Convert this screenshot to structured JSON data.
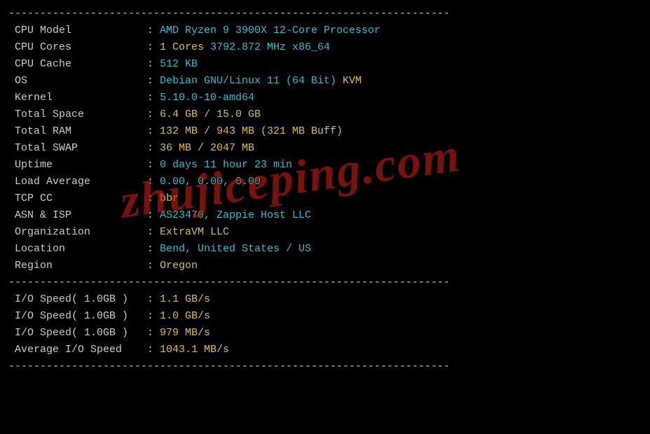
{
  "dash": "----------------------------------------------------------------------",
  "watermark": "zhujiceping.com",
  "rows": [
    {
      "label": "CPU Model            ",
      "parts": [
        {
          "cls": "cyan",
          "txt": "AMD Ryzen 9 3900X 12-Core Processor"
        }
      ]
    },
    {
      "label": "CPU Cores            ",
      "parts": [
        {
          "cls": "yellow",
          "txt": "1 Cores"
        },
        {
          "cls": "cyan",
          "txt": " 3792.872 MHz x86_64"
        }
      ]
    },
    {
      "label": "CPU Cache            ",
      "parts": [
        {
          "cls": "cyan",
          "txt": "512 KB"
        }
      ]
    },
    {
      "label": "OS                   ",
      "parts": [
        {
          "cls": "cyan",
          "txt": "Debian GNU/Linux 11 (64 Bit) "
        },
        {
          "cls": "yellow",
          "txt": "KVM"
        }
      ]
    },
    {
      "label": "Kernel               ",
      "parts": [
        {
          "cls": "cyan",
          "txt": "5.10.0-10-amd64"
        }
      ]
    },
    {
      "label": "Total Space          ",
      "parts": [
        {
          "cls": "yellow",
          "txt": "6.4 GB / 15.0 GB"
        }
      ]
    },
    {
      "label": "Total RAM            ",
      "parts": [
        {
          "cls": "yellow",
          "txt": "132 MB / 943 MB (321 MB Buff)"
        }
      ]
    },
    {
      "label": "Total SWAP           ",
      "parts": [
        {
          "cls": "yellow",
          "txt": "36 MB / 2047 MB"
        }
      ]
    },
    {
      "label": "Uptime               ",
      "parts": [
        {
          "cls": "cyan",
          "txt": "0 days 11 hour 23 min"
        }
      ]
    },
    {
      "label": "Load Average         ",
      "parts": [
        {
          "cls": "cyan",
          "txt": "0.00, 0.00, 0.00"
        }
      ]
    },
    {
      "label": "TCP CC               ",
      "parts": [
        {
          "cls": "yellow",
          "txt": "bbr"
        }
      ]
    },
    {
      "label": "ASN & ISP            ",
      "parts": [
        {
          "cls": "cyan",
          "txt": "AS23470, Zappie Host LLC"
        }
      ]
    },
    {
      "label": "Organization         ",
      "parts": [
        {
          "cls": "yellow",
          "txt": "ExtraVM LLC"
        }
      ]
    },
    {
      "label": "Location             ",
      "parts": [
        {
          "cls": "cyan",
          "txt": "Bend, United States / US"
        }
      ]
    },
    {
      "label": "Region               ",
      "parts": [
        {
          "cls": "yellow",
          "txt": "Oregon"
        }
      ]
    }
  ],
  "io_rows": [
    {
      "label": "I/O Speed( 1.0GB )   ",
      "parts": [
        {
          "cls": "yellow",
          "txt": "1.1 GB/s"
        }
      ]
    },
    {
      "label": "I/O Speed( 1.0GB )   ",
      "parts": [
        {
          "cls": "yellow",
          "txt": "1.0 GB/s"
        }
      ]
    },
    {
      "label": "I/O Speed( 1.0GB )   ",
      "parts": [
        {
          "cls": "yellow",
          "txt": "979 MB/s"
        }
      ]
    },
    {
      "label": "Average I/O Speed    ",
      "parts": [
        {
          "cls": "yellow",
          "txt": "1043.1 MB/s"
        }
      ]
    }
  ]
}
